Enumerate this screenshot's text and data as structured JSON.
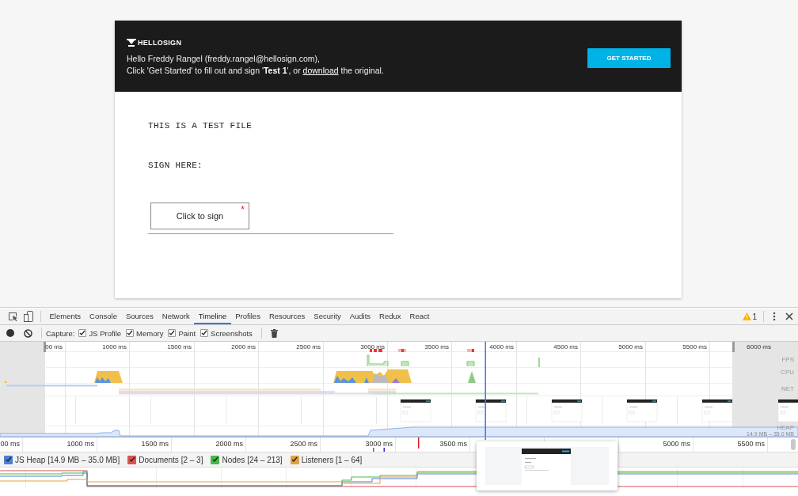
{
  "document_header": {
    "logo": "HELLOSIGN",
    "greeting": "Hello Freddy Rangel (freddy.rangel@hellosign.com),",
    "instruction_before": "Click 'Get Started' to fill out and sign '**Test 1**', or ",
    "link": "download",
    "instruction_after": " the original.",
    "button": "GET STARTED"
  },
  "document": {
    "lines": [
      "THIS IS A TEST FILE",
      "SIGN HERE:"
    ],
    "sign_field": {
      "label": "Click to sign",
      "required_mark": "*"
    }
  },
  "devtools": {
    "tabs": [
      {
        "label": "Elements",
        "selected": false
      },
      {
        "label": "Console",
        "selected": false
      },
      {
        "label": "Sources",
        "selected": false
      },
      {
        "label": "Network",
        "selected": false
      },
      {
        "label": "Timeline",
        "selected": true
      },
      {
        "label": "Profiles",
        "selected": false
      },
      {
        "label": "Resources",
        "selected": false
      },
      {
        "label": "Security",
        "selected": false
      },
      {
        "label": "Audits",
        "selected": false
      },
      {
        "label": "Redux",
        "selected": false
      },
      {
        "label": "React",
        "selected": false
      }
    ],
    "warning_count": "1",
    "capture_label": "Capture:",
    "capture_options": [
      {
        "label": "JS Profile",
        "checked": true
      },
      {
        "label": "Memory",
        "checked": true
      },
      {
        "label": "Paint",
        "checked": true
      },
      {
        "label": "Screenshots",
        "checked": true
      }
    ],
    "overview": {
      "ticks": [
        "00 ms",
        "1000 ms",
        "1500 ms",
        "2000 ms",
        "2500 ms",
        "3000 ms",
        "3500 ms",
        "4000 ms",
        "4500 ms",
        "5000 ms",
        "5500 ms",
        "6000 ms"
      ],
      "lane_labels": [
        "FPS",
        "CPU",
        "NET",
        "HEAP"
      ],
      "heap_range": "14.9 MB – 35.0 MB"
    },
    "ruler_ticks_left": [
      "00 ms",
      "1000 ms",
      "1500 ms",
      "2000 ms",
      "2500 ms",
      "3000 ms",
      "3500 ms"
    ],
    "ruler_ticks_right": [
      "5000 ms",
      "5500 ms"
    ],
    "counters": [
      {
        "label": "JS Heap [14.9 MB – 35.0 MB]",
        "checked": true,
        "color": "#4a7fd8"
      },
      {
        "label": "Documents [2 – 3]",
        "checked": true,
        "color": "#d9534f"
      },
      {
        "label": "Nodes [24 – 213]",
        "checked": true,
        "color": "#47b94a"
      },
      {
        "label": "Listeners [1 – 64]",
        "checked": true,
        "color": "#e0a040"
      }
    ]
  }
}
